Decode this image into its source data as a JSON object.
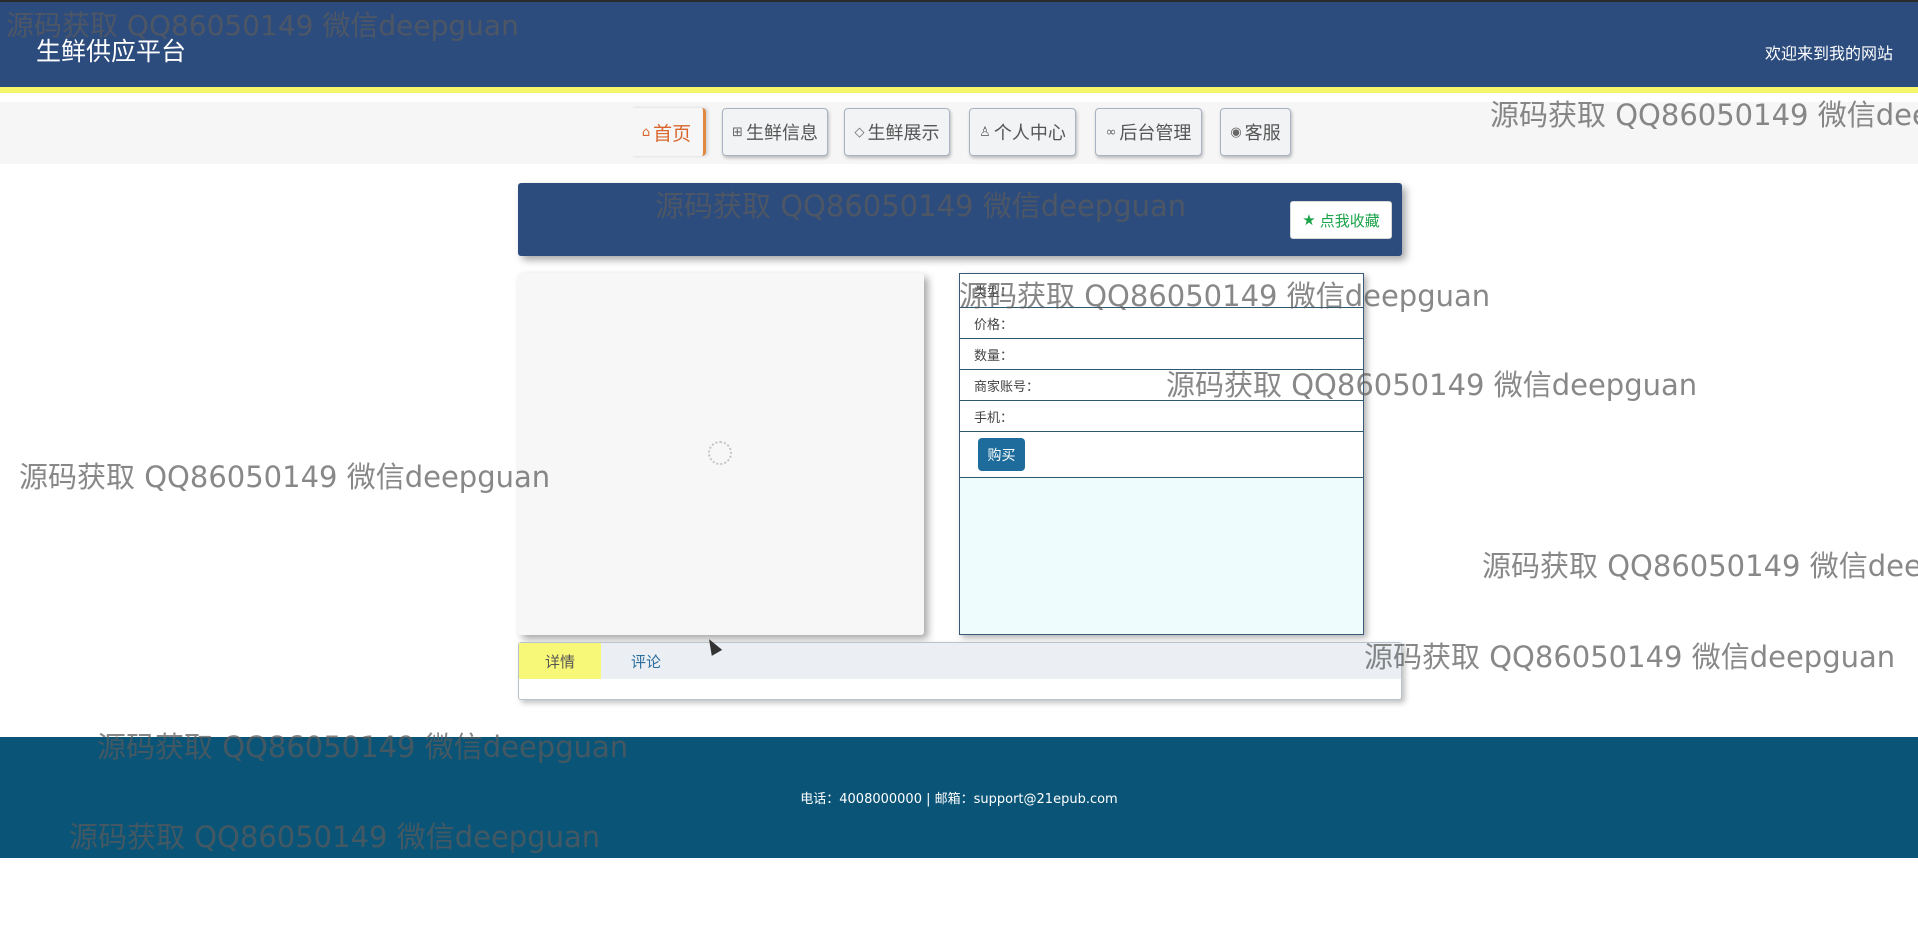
{
  "header": {
    "site_title": "生鲜供应平台",
    "welcome": "欢迎来到我的网站"
  },
  "nav": {
    "items": [
      {
        "label": "首页",
        "icon": "home-icon"
      },
      {
        "label": "生鲜信息",
        "icon": "gift-icon"
      },
      {
        "label": "生鲜展示",
        "icon": "tag-icon"
      },
      {
        "label": "个人中心",
        "icon": "user-icon"
      },
      {
        "label": "后台管理",
        "icon": "link-icon"
      },
      {
        "label": "客服",
        "icon": "chat-icon"
      }
    ]
  },
  "product": {
    "collect_label": "点我收藏",
    "fields": [
      "类型：",
      "价格：",
      "数量：",
      "商家账号：",
      "手机："
    ],
    "buy_label": "购买"
  },
  "tabs": [
    "详情",
    "评论"
  ],
  "footer": {
    "text": "电话：4008000000 | 邮箱：support@21epub.com"
  },
  "watermark": "源码获取 QQ86050149 微信deepguan",
  "colors": {
    "header_bg": "#2d4c7e",
    "accent_yellow": "#f5f56a",
    "footer_bg": "#0a5577",
    "buy_button": "#1e6c9c",
    "collect_green": "#1aa34a"
  }
}
